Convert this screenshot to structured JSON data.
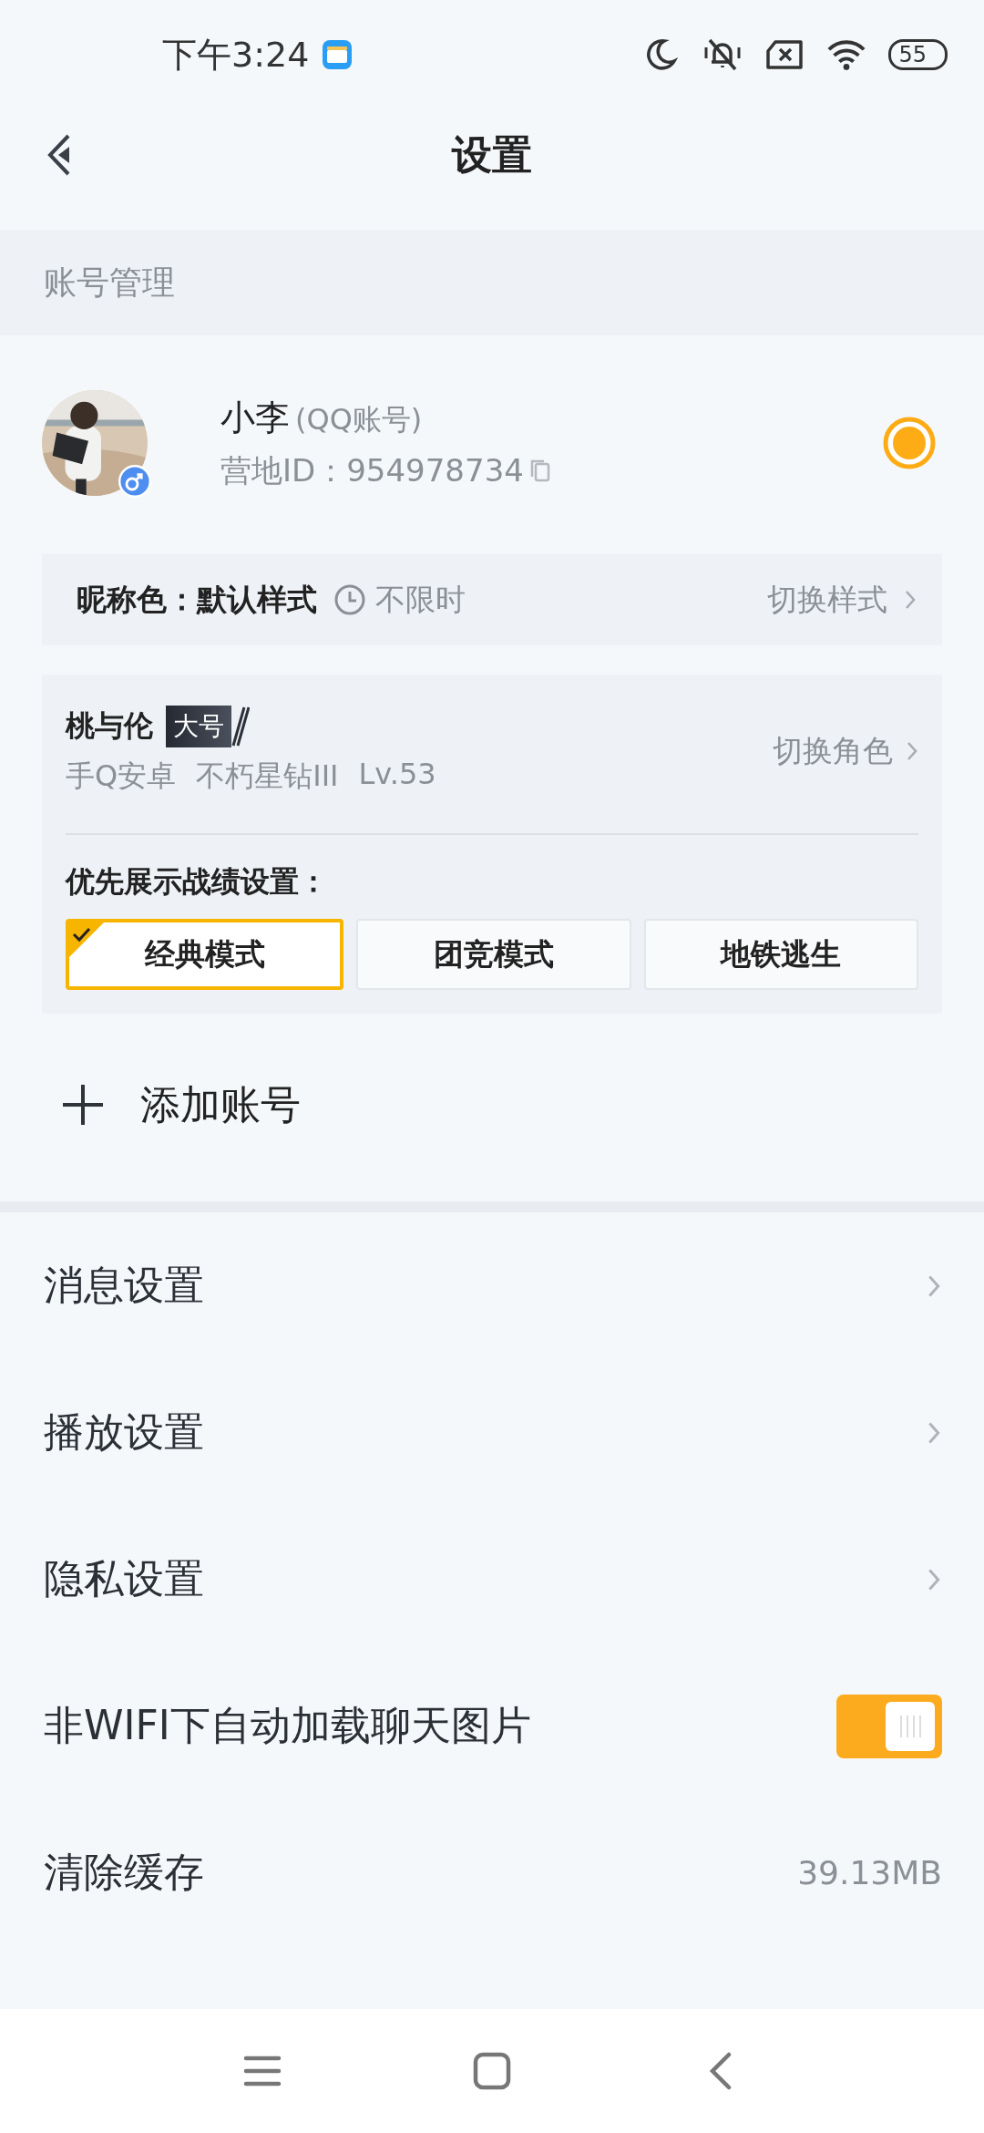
{
  "status_bar": {
    "time": "下午3:24",
    "battery": "55"
  },
  "header": {
    "title": "设置"
  },
  "account_section": {
    "title": "账号管理",
    "account": {
      "name": "小李",
      "account_type": "(QQ账号)",
      "id_label": "营地ID：",
      "id": "954978734",
      "selected": true
    },
    "nickname": {
      "label": "昵称色：",
      "style": "默认样式",
      "duration": "不限时",
      "action": "切换样式"
    },
    "role": {
      "name": "桃与伦",
      "badge": "大号",
      "details": [
        "手Q安卓",
        "不朽星钻III",
        "Lv.53"
      ],
      "action": "切换角色",
      "priority_label": "优先展示战绩设置：",
      "modes": [
        {
          "label": "经典模式",
          "selected": true
        },
        {
          "label": "团竞模式",
          "selected": false
        },
        {
          "label": "地铁逃生",
          "selected": false
        }
      ]
    },
    "add_account": "添加账号"
  },
  "settings": [
    {
      "kind": "link",
      "label": "消息设置"
    },
    {
      "kind": "link",
      "label": "播放设置"
    },
    {
      "kind": "link",
      "label": "隐私设置"
    },
    {
      "kind": "toggle",
      "label": "非WIFI下自动加载聊天图片",
      "on": true
    },
    {
      "kind": "value",
      "label": "清除缓存",
      "value": "39.13MB"
    }
  ]
}
